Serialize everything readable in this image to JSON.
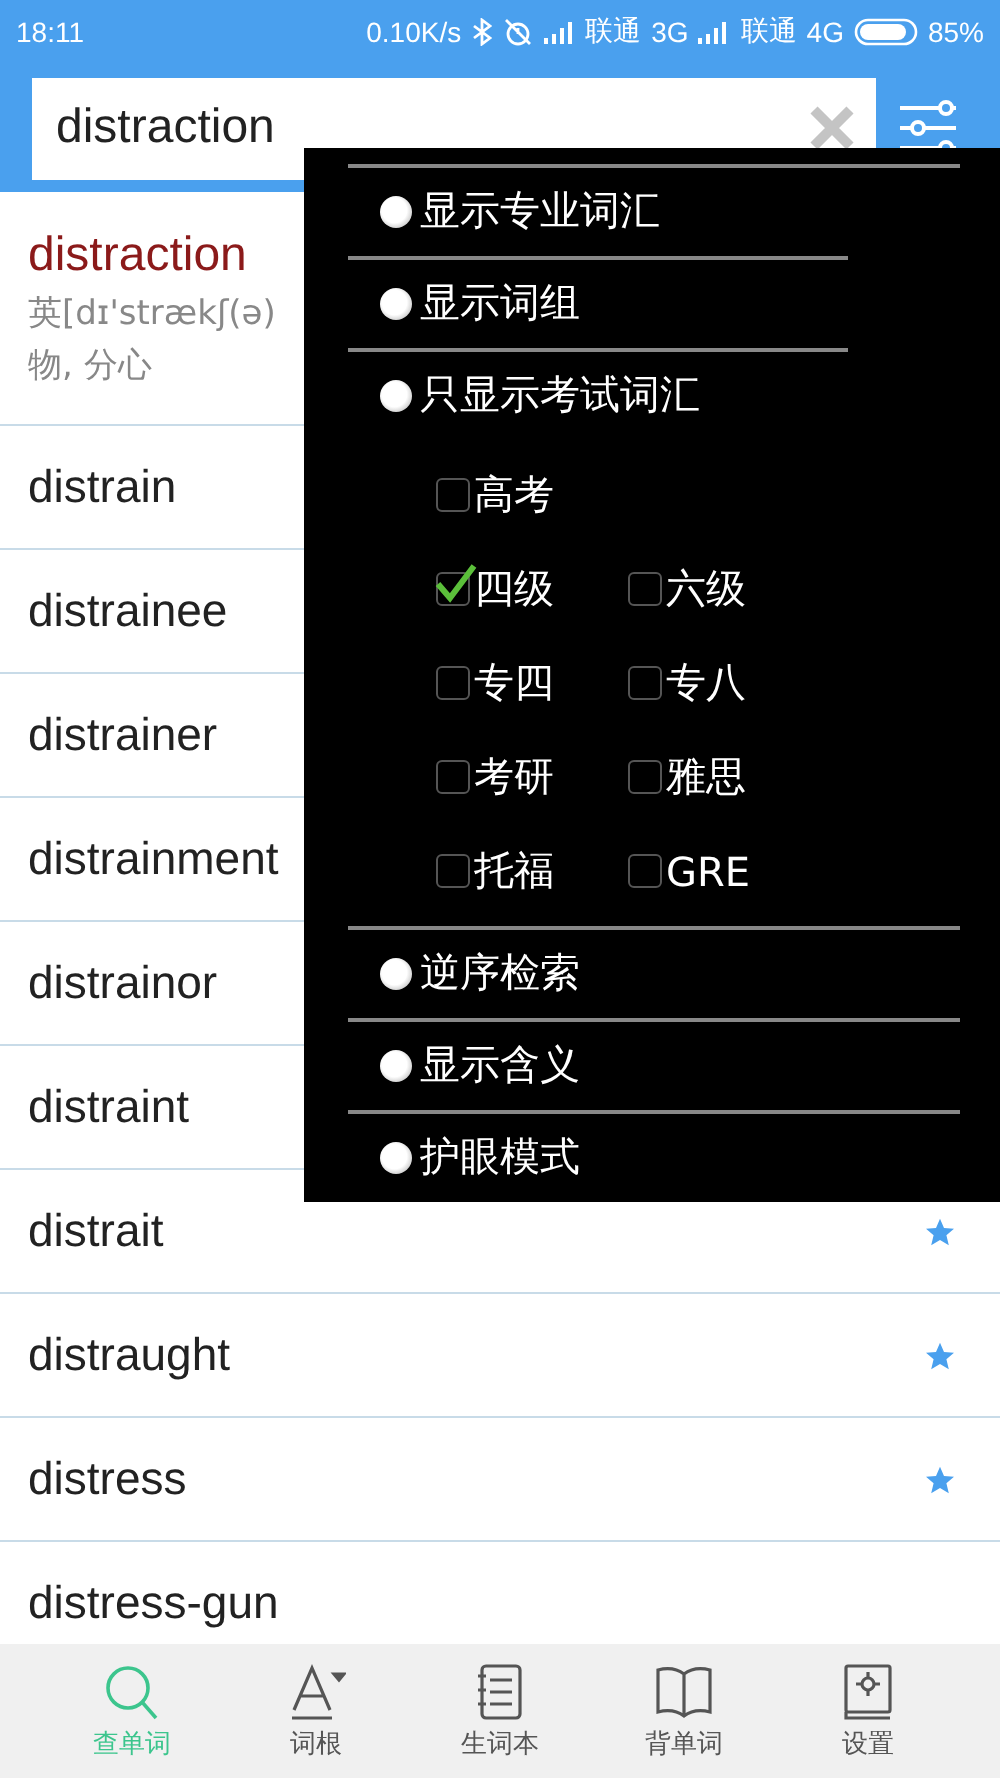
{
  "status_bar": {
    "time": "18:11",
    "net_speed": "0.10K/s",
    "carriers": [
      {
        "name": "联通",
        "network": "3G"
      },
      {
        "name": "联通",
        "network": "4G"
      }
    ],
    "battery": "85%"
  },
  "search": {
    "value": "distraction"
  },
  "entry": {
    "word": "distraction",
    "phonetic": "英[dɪ'strækʃ(ə)",
    "meaning": "物, 分心"
  },
  "words": [
    {
      "word": "distrain"
    },
    {
      "word": "distrainee"
    },
    {
      "word": "distrainer"
    },
    {
      "word": "distrainment"
    },
    {
      "word": "distrainor"
    },
    {
      "word": "distraint"
    },
    {
      "word": "distrait",
      "starred": true
    },
    {
      "word": "distraught",
      "starred": true
    },
    {
      "word": "distress",
      "starred": true
    },
    {
      "word": "distress-gun",
      "starred": false
    }
  ],
  "menu": [
    {
      "kind": "option",
      "label": "显示专业词汇"
    },
    {
      "kind": "option",
      "label": "显示词组"
    },
    {
      "kind": "option",
      "label": "只显示考试词汇"
    },
    {
      "kind": "checks",
      "rows": [
        [
          {
            "label": "高考",
            "checked": false
          }
        ],
        [
          {
            "label": "四级",
            "checked": true
          },
          {
            "label": "六级",
            "checked": false
          }
        ],
        [
          {
            "label": "专四",
            "checked": false
          },
          {
            "label": "专八",
            "checked": false
          }
        ],
        [
          {
            "label": "考研",
            "checked": false
          },
          {
            "label": "雅思",
            "checked": false
          }
        ],
        [
          {
            "label": "托福",
            "checked": false
          },
          {
            "label": "GRE",
            "checked": false
          }
        ]
      ]
    },
    {
      "kind": "option",
      "label": "逆序检索"
    },
    {
      "kind": "option",
      "label": "显示含义"
    },
    {
      "kind": "option",
      "label": "护眼模式"
    }
  ],
  "tabs": [
    {
      "label": "查单词",
      "selected": true
    },
    {
      "label": "词根",
      "selected": false
    },
    {
      "label": "生词本",
      "selected": false
    },
    {
      "label": "背单词",
      "selected": false
    },
    {
      "label": "设置",
      "selected": false
    }
  ]
}
